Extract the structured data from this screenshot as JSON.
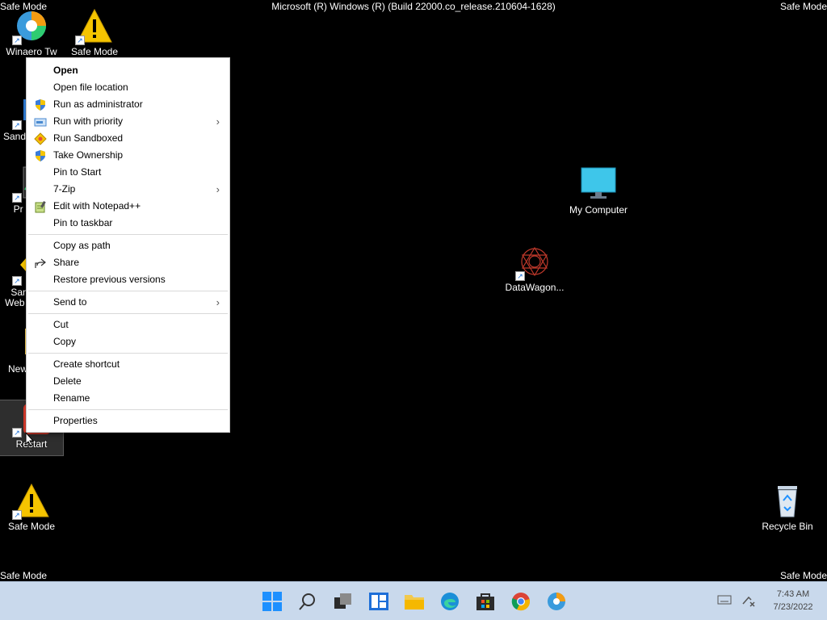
{
  "watermark": {
    "top_left": "Safe Mode",
    "top_right": "Safe Mode",
    "bottom_left": "Safe Mode",
    "bottom_right": "Safe Mode",
    "build": "Microsoft (R) Windows (R) (Build 22000.co_release.210604-1628)"
  },
  "desktop": {
    "icons": {
      "winaero": "Winaero Tw",
      "safemode_top": "Safe Mode",
      "sandboxie": "Sandb",
      "process_hacker": "Pr Ha",
      "sandboxed_web": "San Web B",
      "new_folder": "New",
      "restart": "Restart",
      "safemode_bottom": "Safe Mode",
      "my_computer": "My Computer",
      "datawagon": "DataWagon...",
      "recycle_bin": "Recycle Bin"
    }
  },
  "context_menu": {
    "open": "Open",
    "open_file_location": "Open file location",
    "run_as_admin": "Run as administrator",
    "run_with_priority": "Run with priority",
    "run_sandboxed": "Run Sandboxed",
    "take_ownership": "Take Ownership",
    "pin_to_start": "Pin to Start",
    "seven_zip": "7-Zip",
    "edit_notepadpp": "Edit with Notepad++",
    "pin_to_taskbar": "Pin to taskbar",
    "copy_as_path": "Copy as path",
    "share": "Share",
    "restore_previous": "Restore previous versions",
    "send_to": "Send to",
    "cut": "Cut",
    "copy": "Copy",
    "create_shortcut": "Create shortcut",
    "delete": "Delete",
    "rename": "Rename",
    "properties": "Properties",
    "submenu_arrow": "›"
  },
  "taskbar": {
    "time": "7:43 AM",
    "date": "7/23/2022"
  },
  "colors": {
    "taskbar_bg": "#c9d9ec",
    "warning_yellow": "#f5c400",
    "restart_red": "#d93a2b",
    "windows_blue": "#1e90ff"
  }
}
